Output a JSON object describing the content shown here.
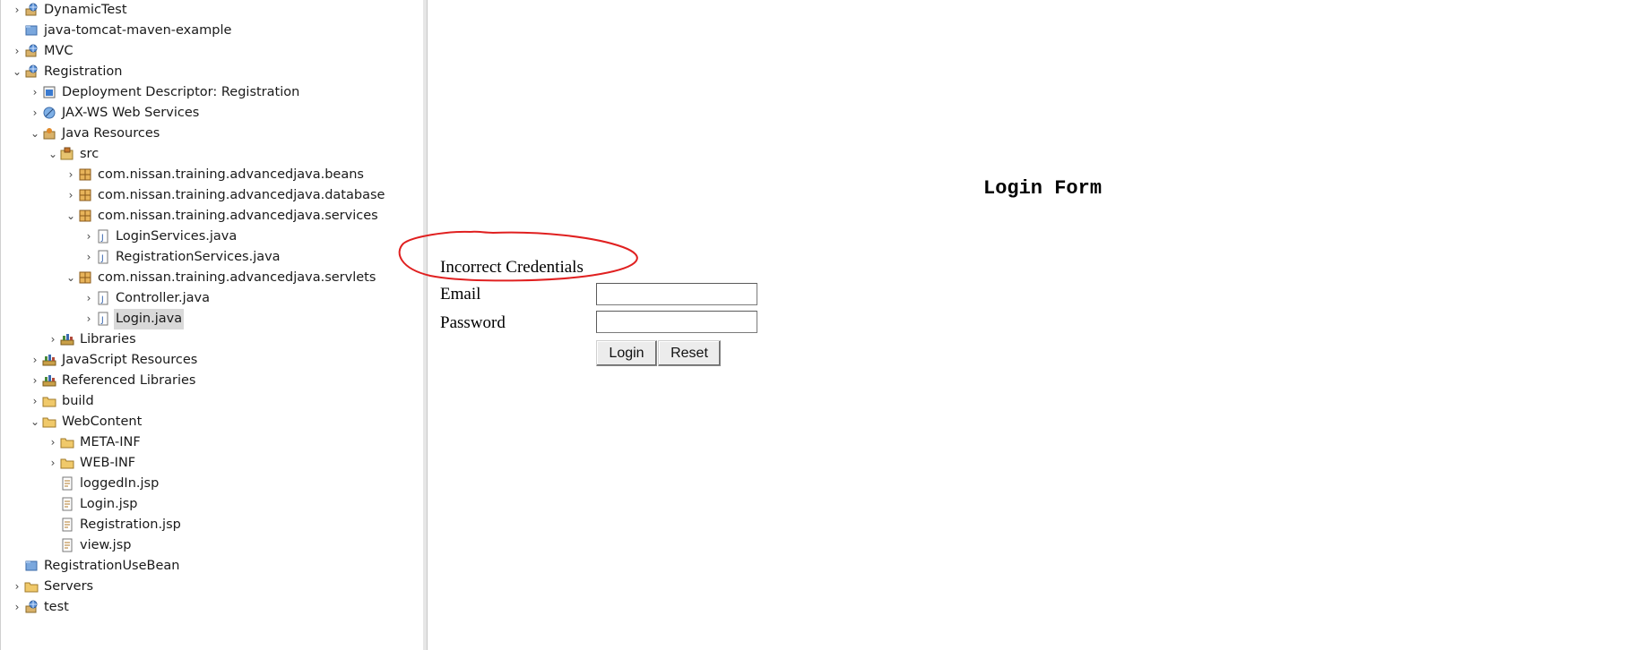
{
  "explorer": {
    "items": [
      {
        "label": "DynamicTest",
        "icon": "web-project-icon",
        "twisty": "collapsed"
      },
      {
        "label": "java-tomcat-maven-example",
        "icon": "project-folder-icon",
        "twisty": "none"
      },
      {
        "label": "MVC",
        "icon": "web-project-icon",
        "twisty": "collapsed"
      },
      {
        "label": "Registration",
        "icon": "web-project-icon",
        "twisty": "expanded"
      },
      {
        "label": "Deployment Descriptor: Registration",
        "icon": "deployment-descriptor-icon",
        "twisty": "collapsed"
      },
      {
        "label": "JAX-WS Web Services",
        "icon": "web-services-icon",
        "twisty": "collapsed"
      },
      {
        "label": "Java Resources",
        "icon": "java-resources-icon",
        "twisty": "expanded"
      },
      {
        "label": "src",
        "icon": "source-folder-icon",
        "twisty": "expanded"
      },
      {
        "label": "com.nissan.training.advancedjava.beans",
        "icon": "package-icon",
        "twisty": "collapsed"
      },
      {
        "label": "com.nissan.training.advancedjava.database",
        "icon": "package-icon",
        "twisty": "collapsed"
      },
      {
        "label": "com.nissan.training.advancedjava.services",
        "icon": "package-icon",
        "twisty": "expanded"
      },
      {
        "label": "LoginServices.java",
        "icon": "java-file-icon",
        "twisty": "collapsed"
      },
      {
        "label": "RegistrationServices.java",
        "icon": "java-file-icon",
        "twisty": "collapsed"
      },
      {
        "label": "com.nissan.training.advancedjava.servlets",
        "icon": "package-icon",
        "twisty": "expanded"
      },
      {
        "label": "Controller.java",
        "icon": "java-file-icon",
        "twisty": "collapsed"
      },
      {
        "label": "Login.java",
        "icon": "java-file-icon",
        "twisty": "collapsed",
        "selected": true
      },
      {
        "label": "Libraries",
        "icon": "library-icon",
        "twisty": "collapsed"
      },
      {
        "label": "JavaScript Resources",
        "icon": "library-icon",
        "twisty": "collapsed"
      },
      {
        "label": "Referenced Libraries",
        "icon": "library-icon",
        "twisty": "collapsed"
      },
      {
        "label": "build",
        "icon": "folder-icon",
        "twisty": "collapsed"
      },
      {
        "label": "WebContent",
        "icon": "folder-icon",
        "twisty": "expanded"
      },
      {
        "label": "META-INF",
        "icon": "folder-icon",
        "twisty": "collapsed"
      },
      {
        "label": "WEB-INF",
        "icon": "folder-icon",
        "twisty": "collapsed"
      },
      {
        "label": "loggedIn.jsp",
        "icon": "jsp-file-icon",
        "twisty": "none"
      },
      {
        "label": "Login.jsp",
        "icon": "jsp-file-icon",
        "twisty": "none"
      },
      {
        "label": "Registration.jsp",
        "icon": "jsp-file-icon",
        "twisty": "none"
      },
      {
        "label": "view.jsp",
        "icon": "jsp-file-icon",
        "twisty": "none"
      },
      {
        "label": "RegistrationUseBean",
        "icon": "project-folder-icon",
        "twisty": "none"
      },
      {
        "label": "Servers",
        "icon": "folder-icon",
        "twisty": "collapsed"
      },
      {
        "label": "test",
        "icon": "web-project-icon",
        "twisty": "collapsed"
      }
    ]
  },
  "login_page": {
    "title": "Login Form",
    "error_message": "Incorrect Credentials",
    "email_label": "Email",
    "password_label": "Password",
    "email_value": "",
    "password_value": "",
    "login_button": "Login",
    "reset_button": "Reset"
  },
  "annotation_color": "#e02020"
}
